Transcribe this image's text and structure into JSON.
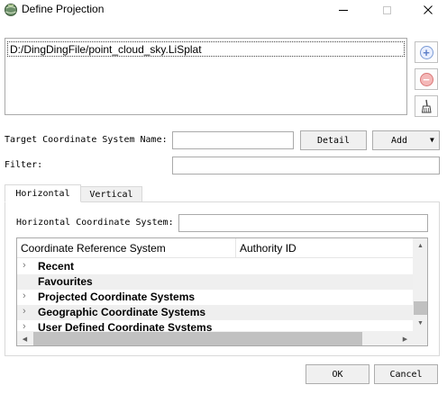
{
  "window": {
    "title": "Define Projection",
    "icon": "globe-app-icon",
    "controls": [
      "minimize-icon",
      "maximize-icon",
      "close-icon"
    ]
  },
  "files": {
    "items": [
      "D:/DingDingFile/point_cloud_sky.LiSplat"
    ],
    "add_icon": "plus-circle-icon",
    "remove_icon": "minus-circle-icon",
    "clear_icon": "broom-icon"
  },
  "target": {
    "label": "Target Coordinate System Name:",
    "value": "",
    "detail_label": "Detail",
    "add_label": "Add"
  },
  "filter": {
    "label": "Filter:",
    "value": ""
  },
  "tabs": [
    {
      "label": "Horizontal",
      "active": true
    },
    {
      "label": "Vertical",
      "active": false
    }
  ],
  "horizontal": {
    "hcs_label": "Horizontal Coordinate System:",
    "hcs_value": "",
    "columns": [
      "Coordinate Reference System",
      "Authority ID"
    ],
    "rows": [
      {
        "label": "Recent",
        "expandable": true
      },
      {
        "label": "Favourites",
        "expandable": false
      },
      {
        "label": "Projected Coordinate Systems",
        "expandable": true
      },
      {
        "label": "Geographic Coordinate Systems",
        "expandable": true
      },
      {
        "label": "User Defined Coordinate Systems",
        "expandable": true
      }
    ]
  },
  "buttons": {
    "ok": "OK",
    "cancel": "Cancel"
  },
  "colors": {
    "alt_row": "#efefef",
    "add_circle": "#5d7fc7",
    "remove_circle": "#f4b7b7"
  }
}
